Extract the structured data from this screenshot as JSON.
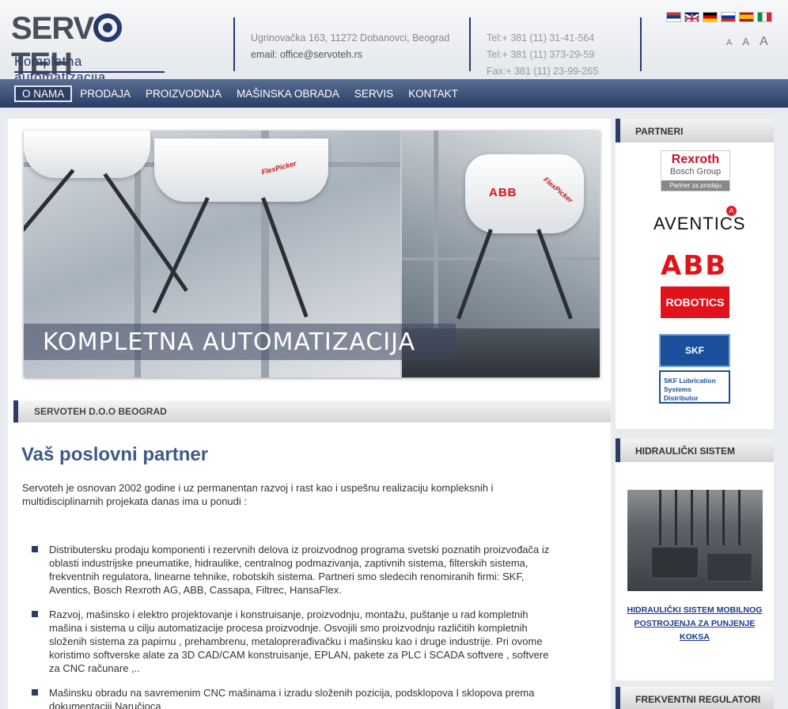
{
  "header": {
    "logo": {
      "wordmark": "SERVOTEH",
      "tagline": "Kompletna automatizacija"
    },
    "address": "Ugrinovačka 163, 11272 Dobanovci, Beograd",
    "email": "email: office@servoteh.rs",
    "phones": [
      "Tel:+ 381 (11) 31-41-564",
      "Tel:+ 381 (11) 373-29-59",
      "Fax:+ 381 (11) 23-99-265"
    ],
    "languages": [
      {
        "name": "serbian-flag",
        "colors": [
          "#c6363c",
          "#0c4076",
          "#ffffff"
        ]
      },
      {
        "name": "english-flag",
        "colors": [
          "#012169",
          "#c8102e",
          "#ffffff"
        ]
      },
      {
        "name": "german-flag",
        "colors": [
          "#000000",
          "#dd0000",
          "#ffce00"
        ]
      },
      {
        "name": "russian-flag",
        "colors": [
          "#ffffff",
          "#0039a6",
          "#d52b1e"
        ]
      },
      {
        "name": "spanish-flag",
        "colors": [
          "#aa151b",
          "#f1bf00",
          "#aa151b"
        ]
      },
      {
        "name": "italian-flag",
        "colors": [
          "#009246",
          "#ffffff",
          "#ce2b37"
        ]
      }
    ],
    "font_size_controls": [
      "A",
      "A",
      "A"
    ]
  },
  "nav": {
    "items": [
      "O NAMA",
      "PRODAJA",
      "PROIZVODNJA",
      "MAŠINSKA OBRADA",
      "SERVIS",
      "KONTAKT"
    ],
    "active": "O NAMA"
  },
  "banner": {
    "caption": "KOMPLETNA AUTOMATIZACIJA",
    "robot_labels": [
      "FlexPicker",
      "FlexPicker"
    ],
    "brand_mark": "ABB"
  },
  "main": {
    "section_title": "SERVOTEH D.O.O BEOGRAD",
    "heading": "Vaš poslovni partner",
    "intro": "Servoteh je osnovan 2002 godine i uz permanentan razvoj i rast kao i uspešnu realizaciju kompleksnih i multidisciplinarnih projekata danas ima u ponudi :",
    "bullets": [
      "Distributersku prodaju  komponenti i rezervnih delova iz proizvodnog programa svetski poznatih proizvođača iz oblasti industrijske pneumatike, hidraulike, centralnog podmazivanja, zaptivnih sistema, filterskih sistema, frekventnih regulatora, linearne tehnike, robotskih sistema.  Partneri smo sledecih renomiranih firmi: SKF, Aventics, Bosch Rexroth AG, ABB, Cassapa, Filtrec, HansaFlex.",
      "Razvoj, mašinsko i elektro projektovanje i konstruisanje, proizvodnju, montažu, puštanje u rad kompletnih mašina i sistema u cilju automatizacije procesa proizvodnje. Osvojili smo proizvodnju različitih  kompletnih složenih sistema za papirnu , prehambrenu, metaloprerađivačku i mašinsku kao i druge industrije. Pri ovome koristimo softverske alate za 3D CAD/CAM konstruisanje, EPLAN, pakete za PLC i SCADA  softvere , softvere za CNC računare ,..",
      "Mašinsku obradu na savremenim CNC mašinama i izradu složenih pozicija, podsklopova I sklopova prema dokumentaciji Naručioca"
    ]
  },
  "sidebar": {
    "partners": {
      "title": "PARTNERI",
      "rexroth": {
        "name": "Rexroth",
        "sub": "Bosch Group",
        "badge": "Partner za prodaju"
      },
      "aventics": "AVENTICS",
      "abb": "ABB",
      "robotics": "ROBOTICS",
      "skf": "SKF",
      "skf_distributor": "SKF Lubrication Systems Distributor"
    },
    "hydraulic": {
      "title": "HIDRAULIČKI SISTEM",
      "link": "HIDRAULIČKI SISTEM MOBILNOG POSTROJENJA ZA PUNJENJE KOKSA"
    },
    "frequency": {
      "title": "FREKVENTNI REGULATORI"
    }
  }
}
